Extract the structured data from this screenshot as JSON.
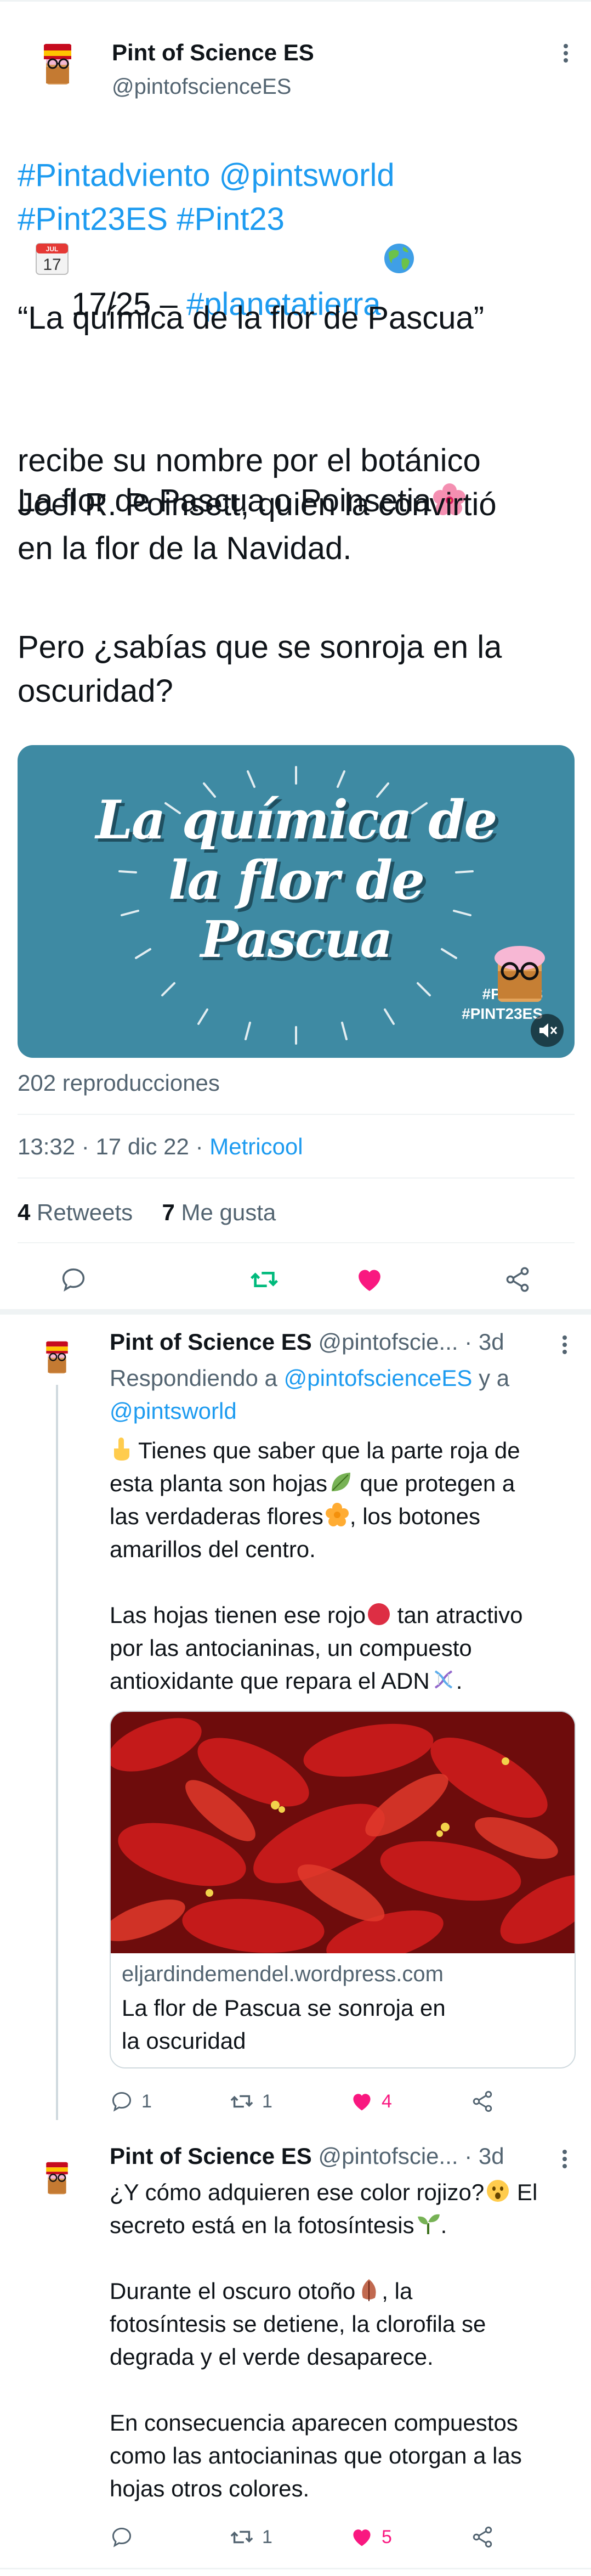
{
  "tweet": {
    "author_name": "Pint of Science ES",
    "author_handle": "@pintofscienceES",
    "line1_prefix": "17/25 – ",
    "hashtag_planeta": "#planetatierra",
    "line2": "#Pintadviento @pintsworld",
    "line3": "#Pint23ES #Pint23",
    "quote": "“La química de la flor de Pascua”",
    "para1_a": "La flor de Pascua o Poinsetia",
    "para1_b": "recibe su nombre por el botánico",
    "para1_c": "Joel R. Poinsett, quien la convirtió",
    "para1_d": "en la flor de la Navidad.",
    "para2_a": "Pero ¿sabías que se sonroja en la",
    "para2_b": "oscuridad?",
    "media": {
      "title_line1": "La química de",
      "title_line2": "la flor de",
      "title_line3": "Pascua",
      "tag1": "#PINT23",
      "tag2": "#PINT23ES",
      "calendar_month": "JUL",
      "calendar_day": "17"
    },
    "views": "202 reproducciones",
    "time": "13:32",
    "date": "17 dic 22",
    "source": "Metricool",
    "retweets_count": "4",
    "retweets_label": "Retweets",
    "likes_count": "7",
    "likes_label": "Me gusta"
  },
  "replies": [
    {
      "author_name": "Pint of Science ES",
      "author_handle": "@pintofscie...",
      "age": "3d",
      "replying_prefix": "Respondiendo a",
      "replying_to_1": "@pintofscienceES",
      "replying_and": "y a",
      "replying_to_2": "@pintsworld",
      "text_lines": [
        "Tienes que saber que la parte roja de",
        "esta planta son hojas",
        " que protegen a",
        "las verdaderas flores",
        ", los botones",
        "amarillos del centro.",
        "Las hojas tienen ese rojo",
        " tan atractivo",
        "por las antocianinas, un compuesto",
        "antioxidante que repara el ADN",
        "."
      ],
      "card_domain": "eljardindemendel.wordpress.com",
      "card_title_1": "La flor de Pascua se sonroja en",
      "card_title_2": "la oscuridad",
      "replies_count": "1",
      "retweets_count": "1",
      "likes_count": "4"
    },
    {
      "author_name": "Pint of Science ES",
      "author_handle": "@pintofscie...",
      "age": "3d",
      "text_lines": [
        "¿Y cómo adquieren ese color rojizo?",
        " El",
        "secreto está en la fotosíntesis",
        ".",
        "Durante el oscuro otoño",
        ", la",
        "fotosíntesis se detiene, la clorofila se",
        "degrada y el verde desaparece.",
        "En consecuencia aparecen compuestos",
        "como las antocianinas que otorgan a las",
        "hojas otros colores."
      ],
      "replies_count": "",
      "retweets_count": "1",
      "likes_count": "5"
    }
  ],
  "icons": {
    "reply": "reply-icon",
    "retweet": "retweet-icon",
    "like": "heart-icon",
    "share": "share-icon"
  },
  "colors": {
    "link": "#1d9bf0",
    "retweet_active": "#00ba7c",
    "like_active": "#f91880",
    "muted": "#536471",
    "banner_bg": "#3e8aa3"
  }
}
